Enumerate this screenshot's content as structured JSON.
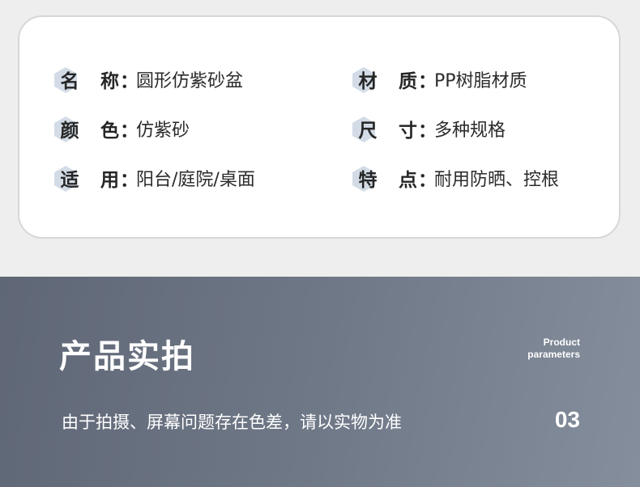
{
  "colors": {
    "badge_hex": "#d3dce6",
    "text_dark": "#262626",
    "section_bg_left": "#5f6776",
    "section_bg_right": "#858e9c"
  },
  "specs": [
    {
      "k1": "名",
      "k2": "称",
      "colon": "：",
      "value": "圆形仿紫砂盆"
    },
    {
      "k1": "材",
      "k2": "质",
      "colon": "：",
      "value": "PP树脂材质"
    },
    {
      "k1": "颜",
      "k2": "色",
      "colon": "：",
      "value": "仿紫砂"
    },
    {
      "k1": "尺",
      "k2": "寸",
      "colon": "：",
      "value": "多种规格"
    },
    {
      "k1": "适",
      "k2": "用",
      "colon": "：",
      "value": "阳台/庭院/桌面"
    },
    {
      "k1": "特",
      "k2": "点",
      "colon": "：",
      "value": "耐用防晒、控根"
    }
  ],
  "section": {
    "title": "产品实拍",
    "en_line1": "Product",
    "en_line2": "parameters",
    "note": "由于拍摄、屏幕问题存在色差，请以实物为准",
    "number": "03"
  }
}
